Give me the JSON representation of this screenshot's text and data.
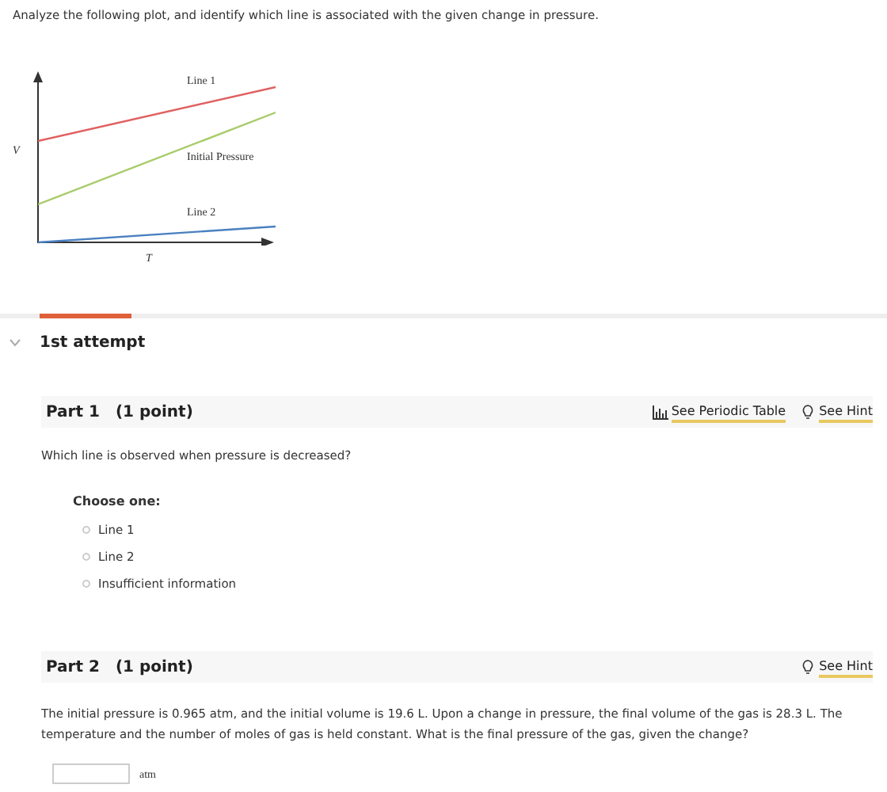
{
  "prompt": "Analyze the following plot, and identify which line is associated with the given change in pressure.",
  "plot": {
    "y_axis_label": "V",
    "x_axis_label": "T",
    "lines": [
      {
        "label": "Line 1",
        "color": "#e06060"
      },
      {
        "label": "Initial Pressure",
        "color": "#a8cc6a"
      },
      {
        "label": "Line 2",
        "color": "#4a80c0"
      }
    ]
  },
  "attempt": {
    "label": "1st attempt",
    "expanded": true
  },
  "parts": [
    {
      "title": "Part 1",
      "points": "(1 point)",
      "periodic_table": "See Periodic Table",
      "hint": "See Hint",
      "question": "Which line is observed when pressure is decreased?",
      "choose_label": "Choose one:",
      "options": [
        {
          "label": "Line 1",
          "selected": false
        },
        {
          "label": "Line 2",
          "selected": false
        },
        {
          "label": "Insufficient information",
          "selected": false
        }
      ]
    },
    {
      "title": "Part 2",
      "points": "(1 point)",
      "hint": "See Hint",
      "question": "The initial pressure is 0.965 atm, and the initial volume is 19.6 L. Upon a change in pressure, the final volume of the gas is 28.3 L. The temperature and the number of moles of gas is held constant. What is the final pressure of the gas, given the change?",
      "unit": "atm"
    }
  ]
}
